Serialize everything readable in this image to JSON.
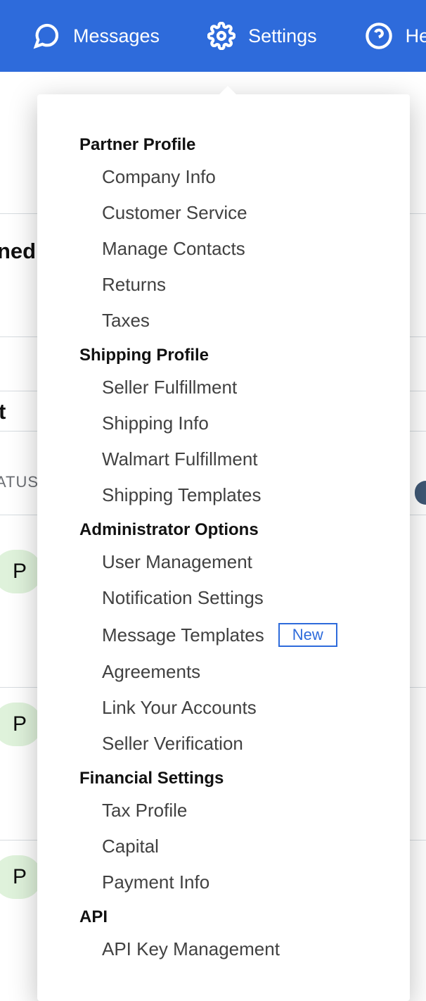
{
  "nav": {
    "messages": "Messages",
    "settings": "Settings",
    "help": "Help"
  },
  "bg": {
    "ned": "ned",
    "t": "t",
    "status_header": "ATUS",
    "pill_p": "P"
  },
  "menu": {
    "sections": [
      {
        "title": "Partner Profile",
        "items": [
          {
            "label": "Company Info"
          },
          {
            "label": "Customer Service"
          },
          {
            "label": "Manage Contacts"
          },
          {
            "label": "Returns"
          },
          {
            "label": "Taxes"
          }
        ]
      },
      {
        "title": "Shipping Profile",
        "items": [
          {
            "label": "Seller Fulfillment"
          },
          {
            "label": "Shipping Info"
          },
          {
            "label": "Walmart Fulfillment"
          },
          {
            "label": "Shipping Templates"
          }
        ]
      },
      {
        "title": "Administrator Options",
        "items": [
          {
            "label": "User Management"
          },
          {
            "label": "Notification Settings"
          },
          {
            "label": "Message Templates",
            "badge": "New"
          },
          {
            "label": "Agreements"
          },
          {
            "label": "Link Your Accounts"
          },
          {
            "label": "Seller Verification"
          }
        ]
      },
      {
        "title": "Financial Settings",
        "items": [
          {
            "label": "Tax Profile"
          },
          {
            "label": "Capital"
          },
          {
            "label": "Payment Info"
          }
        ]
      },
      {
        "title": "API",
        "items": [
          {
            "label": "API Key Management"
          }
        ]
      }
    ]
  }
}
